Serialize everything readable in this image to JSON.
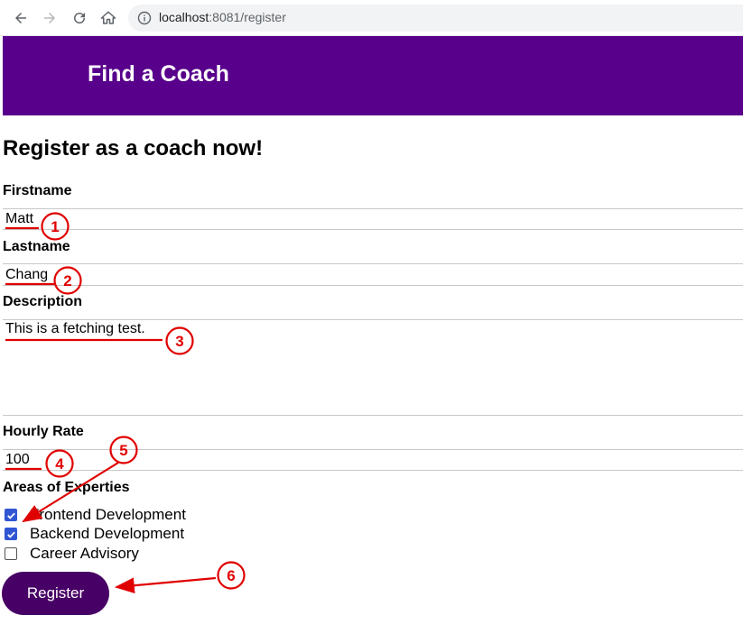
{
  "browser": {
    "url_host": "localhost",
    "url_path": ":8081/register"
  },
  "header": {
    "title": "Find a Coach"
  },
  "form": {
    "heading": "Register as a coach now!",
    "firstname_label": "Firstname",
    "firstname_value": "Matt",
    "lastname_label": "Lastname",
    "lastname_value": "Chang",
    "description_label": "Description",
    "description_value": "This is a fetching test.",
    "rate_label": "Hourly Rate",
    "rate_value": "100",
    "areas_label": "Areas of Experties",
    "areas": [
      {
        "label": "Frontend Development",
        "checked": true
      },
      {
        "label": "Backend Development",
        "checked": true
      },
      {
        "label": "Career Advisory",
        "checked": false
      }
    ],
    "submit_label": "Register"
  },
  "annotations": {
    "color": "#e00000",
    "markers": [
      "1",
      "2",
      "3",
      "4",
      "5",
      "6"
    ]
  },
  "colors": {
    "header_bg": "#58008b",
    "button_bg": "#470065",
    "checkbox_checked": "#3056d3"
  }
}
